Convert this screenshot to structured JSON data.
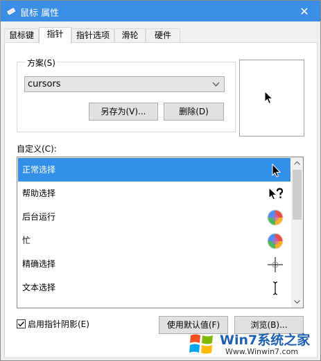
{
  "window": {
    "title": "鼠标 属性",
    "close_glyph": "✕"
  },
  "tabs": [
    {
      "label": "鼠标键",
      "active": false
    },
    {
      "label": "指针",
      "active": true
    },
    {
      "label": "指针选项",
      "active": false
    },
    {
      "label": "滑轮",
      "active": false
    },
    {
      "label": "硬件",
      "active": false
    }
  ],
  "scheme": {
    "label": "方案(S)",
    "selected": "cursors",
    "save_as_label": "另存为(V)...",
    "delete_label": "删除(D)"
  },
  "custom": {
    "label": "自定义(C):",
    "items": [
      {
        "label": "正常选择",
        "icon": "arrow-cursor-icon",
        "selected": true
      },
      {
        "label": "帮助选择",
        "icon": "help-cursor-icon",
        "selected": false
      },
      {
        "label": "后台运行",
        "icon": "busy-wheel-icon",
        "selected": false
      },
      {
        "label": "忙",
        "icon": "busy-wheel-icon",
        "selected": false
      },
      {
        "label": "精确选择",
        "icon": "crosshair-cursor-icon",
        "selected": false
      },
      {
        "label": "文本选择",
        "icon": "text-cursor-icon",
        "selected": false
      }
    ]
  },
  "options": {
    "shadow_label": "启用指针阴影(E)",
    "shadow_checked": true,
    "default_label": "使用默认值(F)",
    "browse_label": "浏览(B)..."
  },
  "watermark": {
    "text": "Win7系统之家",
    "url": "Www.Winwin7.com"
  },
  "colors": {
    "titlebar": "#3a8ee6",
    "selection": "#3390e8"
  }
}
